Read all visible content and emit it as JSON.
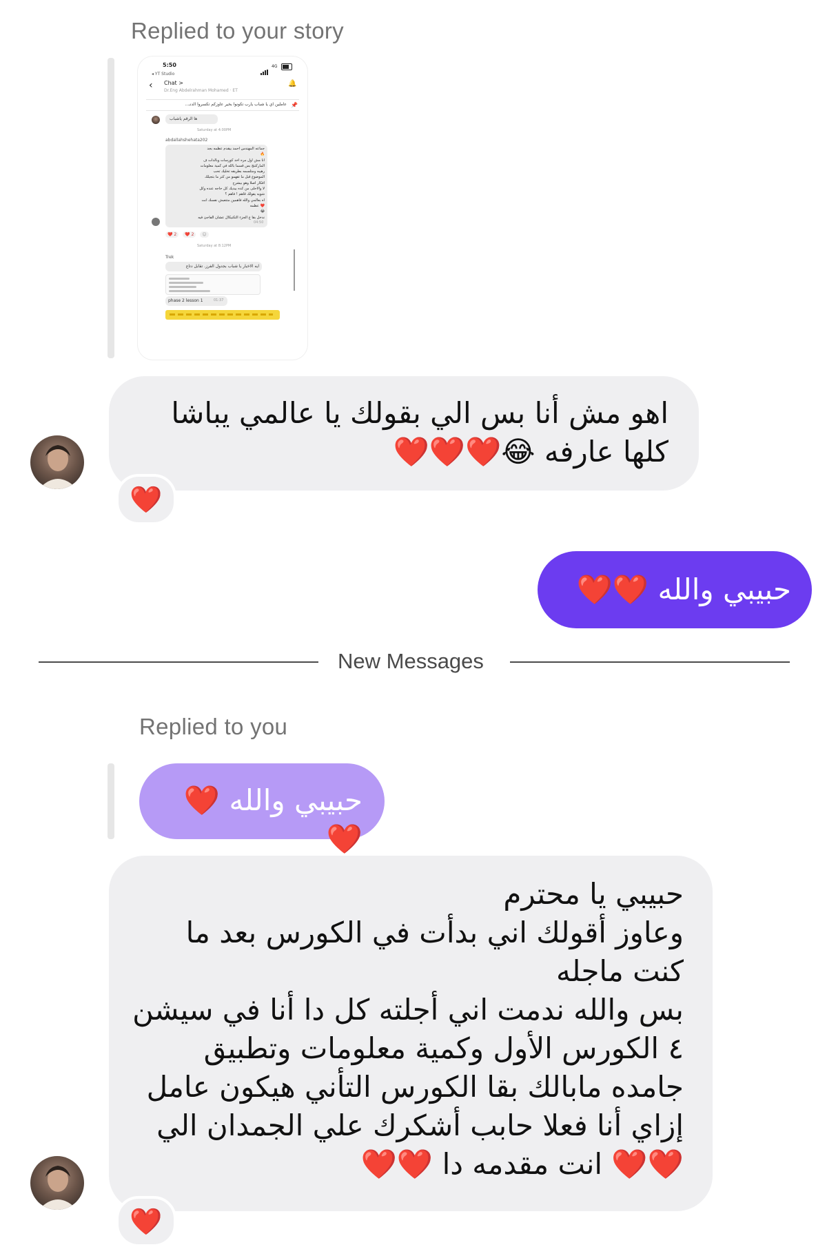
{
  "story_reply": {
    "label": "Replied to your story",
    "thumbnail": {
      "status_time": "5:50",
      "status_sub": "◂ YT Studio",
      "network": "4G",
      "header_title": "Chat >",
      "header_sub": "Dr.Eng Abdelrahman Mohamed · ET",
      "pinned_text": "عاملين اي يا شباب يارب تكونوا بخير عاوزكم تكسروا الدنـ...",
      "reply_chip": "ها الرقم ياشباب",
      "day_label_1": "Saturday at 4:00PM",
      "sender_name": "abdallahshehata202",
      "long_message": "جماعه المهندس احمد بيقدم عظمه بجد\n🔥\nانا مش اول مره اخد كورسات وبالذات ف\nالماركتنج بس قسما بالله في كمية معلومات\nرهيبه ومتلسمه بطريقه تخليك تحب\nالموضوع قبل ما تفهمو من كتر ما بتجيلك\nافكار اصلا وهو بيشرح\nلا والاحلى من كده بيديك كل حاجه عنده وكل\nشويه يقولك قاهم ! فاهم ؟\nاه بعالمي والله فاهمين متتعبش نفسك انت\n❤️ عظمه\n😂\nندخل بقا ع الجزء التكنيكال عشان الفاجئ فيه",
      "long_message_time": "04:50",
      "reactions": [
        "❤️ 2",
        "❤️ 2",
        "☺"
      ],
      "day_label_2": "Saturday at 8:12PM",
      "sender_name_2": "Trek",
      "arabic_chip": "ايه الاخبار يا شباب بجدول الفرز. تقابل دتاع",
      "lesson_chip": "phase 2 lesson 1",
      "lesson_time": "01:37"
    }
  },
  "incoming_1": {
    "text": "اهو مش أنا بس الي بقولك يا عالمي يباشا كلها عارفه 😂❤️❤️❤️",
    "reaction": "❤️"
  },
  "outgoing_1": {
    "text": "حبيبي والله ❤️❤️"
  },
  "divider": {
    "label": "New Messages"
  },
  "reply_to_you": {
    "label": "Replied to you",
    "quoted_text": "حبيبي والله ❤️❤️"
  },
  "incoming_2": {
    "text": "حبيبي يا محترم\nوعاوز أقولك اني بدأت في الكورس بعد ما كنت ماجله\nبس والله ندمت اني أجلته كل دا أنا في سيشن ٤ الكورس الأول وكمية معلومات وتطبيق جامده مابالك بقا الكورس التأني هيكون عامل إزاي أنا فعلا حابب أشكرك علي الجمدان الي ❤️❤️ انت مقدمه دا ❤️❤️",
    "reaction": "❤️"
  },
  "colors": {
    "outgoing_bubble": "#6c3cf0",
    "quoted_bubble": "#b69af6",
    "incoming_bubble": "#efeff1",
    "heart": "#e8112d"
  }
}
